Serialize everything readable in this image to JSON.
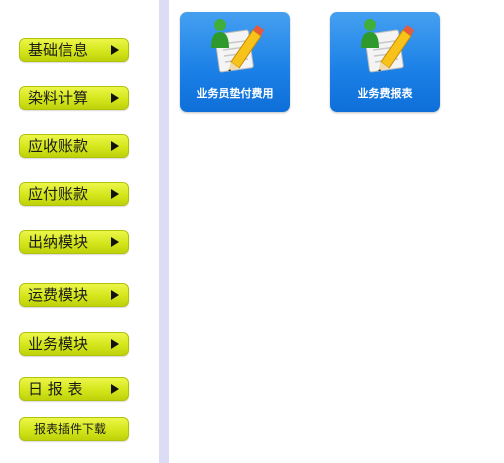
{
  "sidebar": {
    "items": [
      {
        "label": "基础信息"
      },
      {
        "label": "染料计算"
      },
      {
        "label": "应收账款"
      },
      {
        "label": "应付账款"
      },
      {
        "label": "出纳模块"
      },
      {
        "label": "运费模块"
      },
      {
        "label": "业务模块"
      },
      {
        "label": "日 报 表"
      },
      {
        "label": "报表插件下载"
      }
    ]
  },
  "main": {
    "tiles": [
      {
        "label": "业务员垫付费用",
        "icon": "user-edit-icon"
      },
      {
        "label": "业务费报表",
        "icon": "user-edit-icon"
      }
    ]
  },
  "colors": {
    "menu_button": "#d4e61b",
    "tile": "#1a7fe6",
    "divider": "#dcdcf5"
  }
}
